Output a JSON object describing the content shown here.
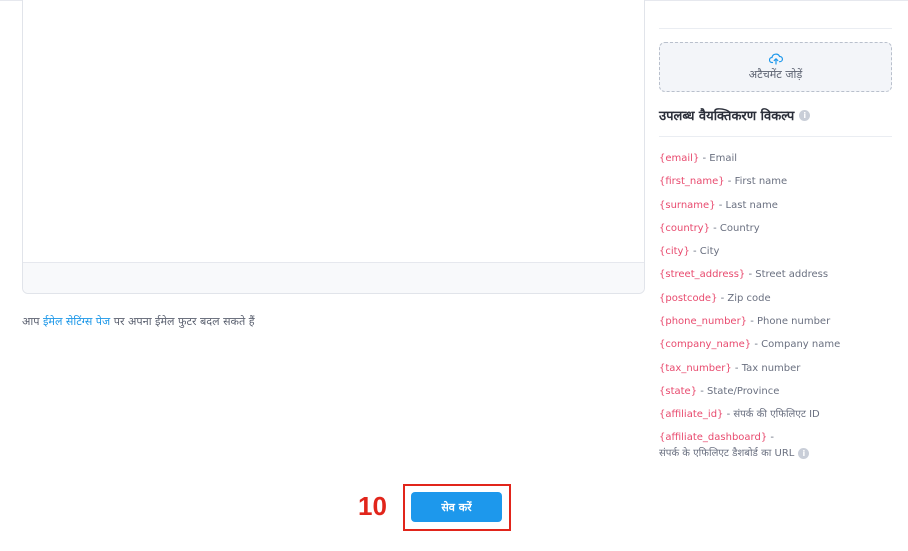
{
  "editor": {
    "footer_note_prefix": "आप ",
    "footer_note_link": "ईमेल सेटिंग्स पेज",
    "footer_note_suffix": " पर अपना ईमेल फुटर बदल सकते हैं"
  },
  "attachment": {
    "icon": "cloud-upload-icon",
    "label": "अटैचमेंट जोड़ें"
  },
  "personalization": {
    "title": "उपलब्ध वैयक्तिकरण विकल्प",
    "info_icon": "info-icon",
    "tokens": [
      {
        "code": "{email}",
        "desc": " - Email"
      },
      {
        "code": "{first_name}",
        "desc": " - First name"
      },
      {
        "code": "{surname}",
        "desc": " - Last name"
      },
      {
        "code": "{country}",
        "desc": " - Country"
      },
      {
        "code": "{city}",
        "desc": " - City"
      },
      {
        "code": "{street_address}",
        "desc": " - Street address"
      },
      {
        "code": "{postcode}",
        "desc": " - Zip code"
      },
      {
        "code": "{phone_number}",
        "desc": " - Phone number"
      },
      {
        "code": "{company_name}",
        "desc": " - Company name"
      },
      {
        "code": "{tax_number}",
        "desc": " - Tax number"
      },
      {
        "code": "{state}",
        "desc": " - State/Province"
      },
      {
        "code": "{affiliate_id}",
        "desc": " - संपर्क की एफिलिएट ID"
      }
    ],
    "dashboard_token": {
      "code": "{affiliate_dashboard}",
      "desc": " -",
      "line2": "संपर्क के एफिलिएट डैशबोर्ड का URL"
    }
  },
  "annotation": {
    "step_number": "10",
    "color": "#e1251b"
  },
  "actions": {
    "save_label": "सेव करें",
    "accent_color": "#1d98ec"
  }
}
